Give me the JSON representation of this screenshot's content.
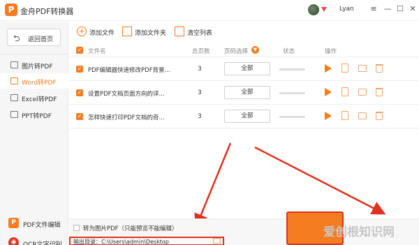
{
  "app": {
    "title": "金舟PDF转换器",
    "logo_letter": "P",
    "username": "Lyan"
  },
  "window_controls": [
    "≡",
    "—",
    "☐",
    "✕"
  ],
  "sidebar": {
    "back_label": "返回首页",
    "items": [
      {
        "label": "图片转PDF",
        "active": false
      },
      {
        "label": "Word转PDF",
        "active": true
      },
      {
        "label": "Excel转PDF",
        "active": false
      },
      {
        "label": "PPT转PDF",
        "active": false
      }
    ],
    "bottom": [
      {
        "label": "PDF文件编辑",
        "icon": "P"
      },
      {
        "label": "OCR文字识别",
        "icon": "◉"
      }
    ]
  },
  "toolbar": {
    "add_file": "添加文件",
    "add_folder": "添加文件夹",
    "clear_list": "清空列表"
  },
  "table": {
    "headers": {
      "name": "文件名",
      "pages": "总页数",
      "range": "页码选择",
      "status": "状态",
      "actions": "操作"
    },
    "rows": [
      {
        "name": "PDF编辑器快速修改PDF背景...",
        "pages": "3",
        "range": "全部",
        "progress": 0
      },
      {
        "name": "设置PDF文档页面方向的详...",
        "pages": "3",
        "range": "全部",
        "progress": 0
      },
      {
        "name": "怎样快速打印PDF文档的奇...",
        "pages": "3",
        "range": "全部",
        "progress": 0
      }
    ]
  },
  "bottom": {
    "to_image_pdf": "转为图片PDF（只能预览不能编辑）",
    "output_dir": "输出目录：C:\\Users\\admin\\Desktop"
  },
  "watermark": "爱创根知识网",
  "colors": {
    "accent": "#f57c20",
    "highlight": "#e0301e"
  }
}
